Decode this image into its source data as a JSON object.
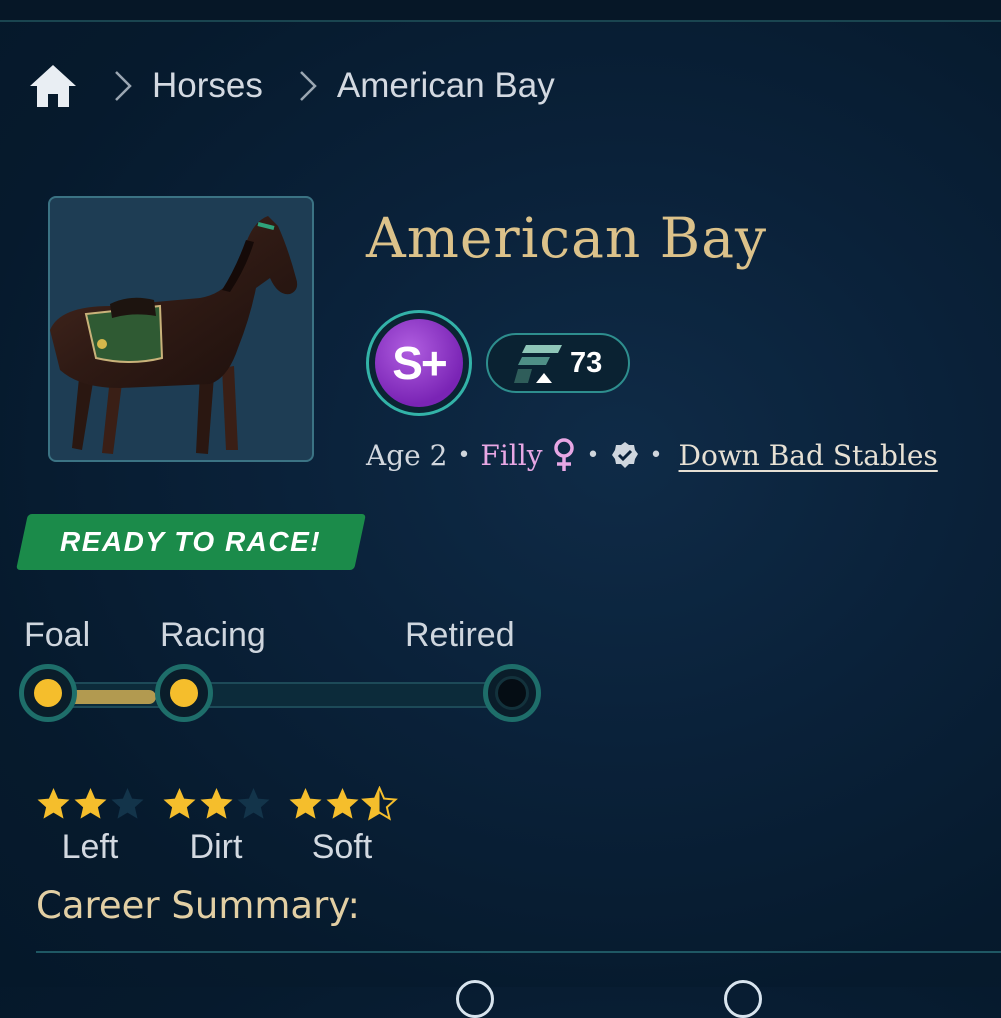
{
  "breadcrumb": {
    "home_icon": "home-icon",
    "items": [
      "Horses",
      "American Bay"
    ]
  },
  "horse": {
    "name": "American Bay",
    "grade": "S+",
    "rating": "73",
    "age": "Age 2",
    "gender": "Filly",
    "stable": "Down Bad Stables"
  },
  "status": {
    "label": "READY TO RACE!"
  },
  "lifecycle": {
    "stages": [
      "Foal",
      "Racing",
      "Retired"
    ],
    "completed_stages": 2
  },
  "aptitudes": [
    {
      "label": "Left",
      "stars": 2
    },
    {
      "label": "Dirt",
      "stars": 2
    },
    {
      "label": "Soft",
      "stars": 2.5
    }
  ],
  "career": {
    "title": "Career Summary:"
  },
  "colors": {
    "accent_gold": "#dcc28a",
    "ready_green": "#1b8b4a",
    "grade_purple": "#8a2fc6",
    "star_gold": "#f5be2c",
    "female_pink": "#e7a7e4"
  }
}
